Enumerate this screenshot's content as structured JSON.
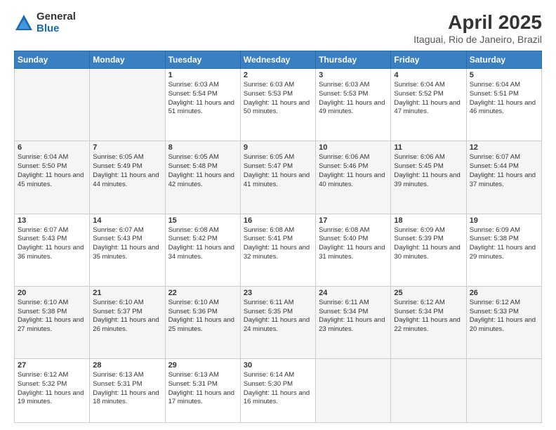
{
  "logo": {
    "general": "General",
    "blue": "Blue"
  },
  "title": "April 2025",
  "subtitle": "Itaguai, Rio de Janeiro, Brazil",
  "headers": [
    "Sunday",
    "Monday",
    "Tuesday",
    "Wednesday",
    "Thursday",
    "Friday",
    "Saturday"
  ],
  "weeks": [
    [
      {
        "day": "",
        "sunrise": "",
        "sunset": "",
        "daylight": ""
      },
      {
        "day": "",
        "sunrise": "",
        "sunset": "",
        "daylight": ""
      },
      {
        "day": "1",
        "sunrise": "Sunrise: 6:03 AM",
        "sunset": "Sunset: 5:54 PM",
        "daylight": "Daylight: 11 hours and 51 minutes."
      },
      {
        "day": "2",
        "sunrise": "Sunrise: 6:03 AM",
        "sunset": "Sunset: 5:53 PM",
        "daylight": "Daylight: 11 hours and 50 minutes."
      },
      {
        "day": "3",
        "sunrise": "Sunrise: 6:03 AM",
        "sunset": "Sunset: 5:53 PM",
        "daylight": "Daylight: 11 hours and 49 minutes."
      },
      {
        "day": "4",
        "sunrise": "Sunrise: 6:04 AM",
        "sunset": "Sunset: 5:52 PM",
        "daylight": "Daylight: 11 hours and 47 minutes."
      },
      {
        "day": "5",
        "sunrise": "Sunrise: 6:04 AM",
        "sunset": "Sunset: 5:51 PM",
        "daylight": "Daylight: 11 hours and 46 minutes."
      }
    ],
    [
      {
        "day": "6",
        "sunrise": "Sunrise: 6:04 AM",
        "sunset": "Sunset: 5:50 PM",
        "daylight": "Daylight: 11 hours and 45 minutes."
      },
      {
        "day": "7",
        "sunrise": "Sunrise: 6:05 AM",
        "sunset": "Sunset: 5:49 PM",
        "daylight": "Daylight: 11 hours and 44 minutes."
      },
      {
        "day": "8",
        "sunrise": "Sunrise: 6:05 AM",
        "sunset": "Sunset: 5:48 PM",
        "daylight": "Daylight: 11 hours and 42 minutes."
      },
      {
        "day": "9",
        "sunrise": "Sunrise: 6:05 AM",
        "sunset": "Sunset: 5:47 PM",
        "daylight": "Daylight: 11 hours and 41 minutes."
      },
      {
        "day": "10",
        "sunrise": "Sunrise: 6:06 AM",
        "sunset": "Sunset: 5:46 PM",
        "daylight": "Daylight: 11 hours and 40 minutes."
      },
      {
        "day": "11",
        "sunrise": "Sunrise: 6:06 AM",
        "sunset": "Sunset: 5:45 PM",
        "daylight": "Daylight: 11 hours and 39 minutes."
      },
      {
        "day": "12",
        "sunrise": "Sunrise: 6:07 AM",
        "sunset": "Sunset: 5:44 PM",
        "daylight": "Daylight: 11 hours and 37 minutes."
      }
    ],
    [
      {
        "day": "13",
        "sunrise": "Sunrise: 6:07 AM",
        "sunset": "Sunset: 5:43 PM",
        "daylight": "Daylight: 11 hours and 36 minutes."
      },
      {
        "day": "14",
        "sunrise": "Sunrise: 6:07 AM",
        "sunset": "Sunset: 5:43 PM",
        "daylight": "Daylight: 11 hours and 35 minutes."
      },
      {
        "day": "15",
        "sunrise": "Sunrise: 6:08 AM",
        "sunset": "Sunset: 5:42 PM",
        "daylight": "Daylight: 11 hours and 34 minutes."
      },
      {
        "day": "16",
        "sunrise": "Sunrise: 6:08 AM",
        "sunset": "Sunset: 5:41 PM",
        "daylight": "Daylight: 11 hours and 32 minutes."
      },
      {
        "day": "17",
        "sunrise": "Sunrise: 6:08 AM",
        "sunset": "Sunset: 5:40 PM",
        "daylight": "Daylight: 11 hours and 31 minutes."
      },
      {
        "day": "18",
        "sunrise": "Sunrise: 6:09 AM",
        "sunset": "Sunset: 5:39 PM",
        "daylight": "Daylight: 11 hours and 30 minutes."
      },
      {
        "day": "19",
        "sunrise": "Sunrise: 6:09 AM",
        "sunset": "Sunset: 5:38 PM",
        "daylight": "Daylight: 11 hours and 29 minutes."
      }
    ],
    [
      {
        "day": "20",
        "sunrise": "Sunrise: 6:10 AM",
        "sunset": "Sunset: 5:38 PM",
        "daylight": "Daylight: 11 hours and 27 minutes."
      },
      {
        "day": "21",
        "sunrise": "Sunrise: 6:10 AM",
        "sunset": "Sunset: 5:37 PM",
        "daylight": "Daylight: 11 hours and 26 minutes."
      },
      {
        "day": "22",
        "sunrise": "Sunrise: 6:10 AM",
        "sunset": "Sunset: 5:36 PM",
        "daylight": "Daylight: 11 hours and 25 minutes."
      },
      {
        "day": "23",
        "sunrise": "Sunrise: 6:11 AM",
        "sunset": "Sunset: 5:35 PM",
        "daylight": "Daylight: 11 hours and 24 minutes."
      },
      {
        "day": "24",
        "sunrise": "Sunrise: 6:11 AM",
        "sunset": "Sunset: 5:34 PM",
        "daylight": "Daylight: 11 hours and 23 minutes."
      },
      {
        "day": "25",
        "sunrise": "Sunrise: 6:12 AM",
        "sunset": "Sunset: 5:34 PM",
        "daylight": "Daylight: 11 hours and 22 minutes."
      },
      {
        "day": "26",
        "sunrise": "Sunrise: 6:12 AM",
        "sunset": "Sunset: 5:33 PM",
        "daylight": "Daylight: 11 hours and 20 minutes."
      }
    ],
    [
      {
        "day": "27",
        "sunrise": "Sunrise: 6:12 AM",
        "sunset": "Sunset: 5:32 PM",
        "daylight": "Daylight: 11 hours and 19 minutes."
      },
      {
        "day": "28",
        "sunrise": "Sunrise: 6:13 AM",
        "sunset": "Sunset: 5:31 PM",
        "daylight": "Daylight: 11 hours and 18 minutes."
      },
      {
        "day": "29",
        "sunrise": "Sunrise: 6:13 AM",
        "sunset": "Sunset: 5:31 PM",
        "daylight": "Daylight: 11 hours and 17 minutes."
      },
      {
        "day": "30",
        "sunrise": "Sunrise: 6:14 AM",
        "sunset": "Sunset: 5:30 PM",
        "daylight": "Daylight: 11 hours and 16 minutes."
      },
      {
        "day": "",
        "sunrise": "",
        "sunset": "",
        "daylight": ""
      },
      {
        "day": "",
        "sunrise": "",
        "sunset": "",
        "daylight": ""
      },
      {
        "day": "",
        "sunrise": "",
        "sunset": "",
        "daylight": ""
      }
    ]
  ]
}
